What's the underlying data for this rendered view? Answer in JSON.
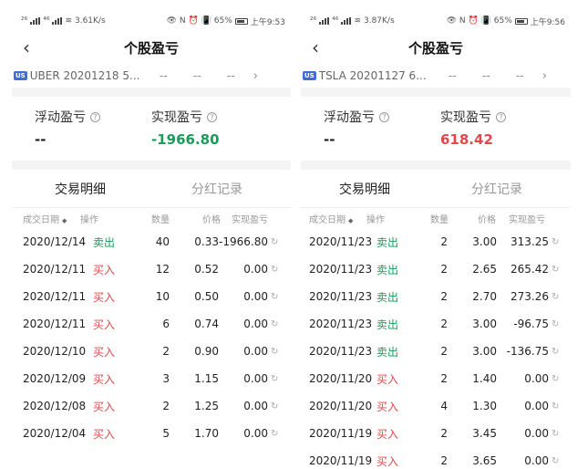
{
  "colors": {
    "sell": "#1a9b5c",
    "buy": "#e0484a",
    "loss": "#1a9b5c",
    "gain": "#e0484a",
    "us_badge": "#3d6fd6"
  },
  "left": {
    "status": {
      "signal1": "²⁶",
      "signal2": "⁴⁶",
      "speed": "3.61K/s",
      "icons": "👁 N ⏰ 📳",
      "battery": "65%",
      "time": "上午9:53"
    },
    "title": "个股盈亏",
    "back_icon": "chevron-left-icon",
    "stock": {
      "badge": "US",
      "name": "UBER 20201218 5...",
      "dash1": "--",
      "dash2": "--",
      "dash3": "--"
    },
    "floating": {
      "label": "浮动盈亏",
      "value": "--"
    },
    "realized": {
      "label": "实现盈亏",
      "value": "-1966.80"
    },
    "tabs": {
      "trades": "交易明细",
      "dividends": "分红记录"
    },
    "headers": {
      "date": "成交日期",
      "op": "操作",
      "qty": "数量",
      "price": "价格",
      "pnl": "实现盈亏"
    },
    "rows": [
      {
        "date": "2020/12/14",
        "op": "卖出",
        "qty": "40",
        "price": "0.33",
        "pnl": "-1966.80"
      },
      {
        "date": "2020/12/11",
        "op": "买入",
        "qty": "12",
        "price": "0.52",
        "pnl": "0.00"
      },
      {
        "date": "2020/12/11",
        "op": "买入",
        "qty": "10",
        "price": "0.50",
        "pnl": "0.00"
      },
      {
        "date": "2020/12/11",
        "op": "买入",
        "qty": "6",
        "price": "0.74",
        "pnl": "0.00"
      },
      {
        "date": "2020/12/10",
        "op": "买入",
        "qty": "2",
        "price": "0.90",
        "pnl": "0.00"
      },
      {
        "date": "2020/12/09",
        "op": "买入",
        "qty": "3",
        "price": "1.15",
        "pnl": "0.00"
      },
      {
        "date": "2020/12/08",
        "op": "买入",
        "qty": "2",
        "price": "1.25",
        "pnl": "0.00"
      },
      {
        "date": "2020/12/04",
        "op": "买入",
        "qty": "5",
        "price": "1.70",
        "pnl": "0.00"
      }
    ]
  },
  "right": {
    "status": {
      "signal1": "²⁶",
      "signal2": "⁴⁶",
      "speed": "3.87K/s",
      "icons": "👁 N ⏰ 📳",
      "battery": "65%",
      "time": "上午9:56"
    },
    "title": "个股盈亏",
    "back_icon": "chevron-left-icon",
    "stock": {
      "badge": "US",
      "name": "TSLA 20201127 6...",
      "dash1": "--",
      "dash2": "--",
      "dash3": "--"
    },
    "floating": {
      "label": "浮动盈亏",
      "value": "--"
    },
    "realized": {
      "label": "实现盈亏",
      "value": "618.42"
    },
    "tabs": {
      "trades": "交易明细",
      "dividends": "分红记录"
    },
    "headers": {
      "date": "成交日期",
      "op": "操作",
      "qty": "数量",
      "price": "价格",
      "pnl": "实现盈亏"
    },
    "rows": [
      {
        "date": "2020/11/23",
        "op": "卖出",
        "qty": "2",
        "price": "3.00",
        "pnl": "313.25"
      },
      {
        "date": "2020/11/23",
        "op": "卖出",
        "qty": "2",
        "price": "2.65",
        "pnl": "265.42"
      },
      {
        "date": "2020/11/23",
        "op": "卖出",
        "qty": "2",
        "price": "2.70",
        "pnl": "273.26"
      },
      {
        "date": "2020/11/23",
        "op": "卖出",
        "qty": "2",
        "price": "3.00",
        "pnl": "-96.75"
      },
      {
        "date": "2020/11/23",
        "op": "卖出",
        "qty": "2",
        "price": "3.00",
        "pnl": "-136.75"
      },
      {
        "date": "2020/11/20",
        "op": "买入",
        "qty": "2",
        "price": "1.40",
        "pnl": "0.00"
      },
      {
        "date": "2020/11/20",
        "op": "买入",
        "qty": "4",
        "price": "1.30",
        "pnl": "0.00"
      },
      {
        "date": "2020/11/19",
        "op": "买入",
        "qty": "2",
        "price": "3.45",
        "pnl": "0.00"
      },
      {
        "date": "2020/11/19",
        "op": "买入",
        "qty": "2",
        "price": "3.65",
        "pnl": "0.00"
      }
    ]
  }
}
